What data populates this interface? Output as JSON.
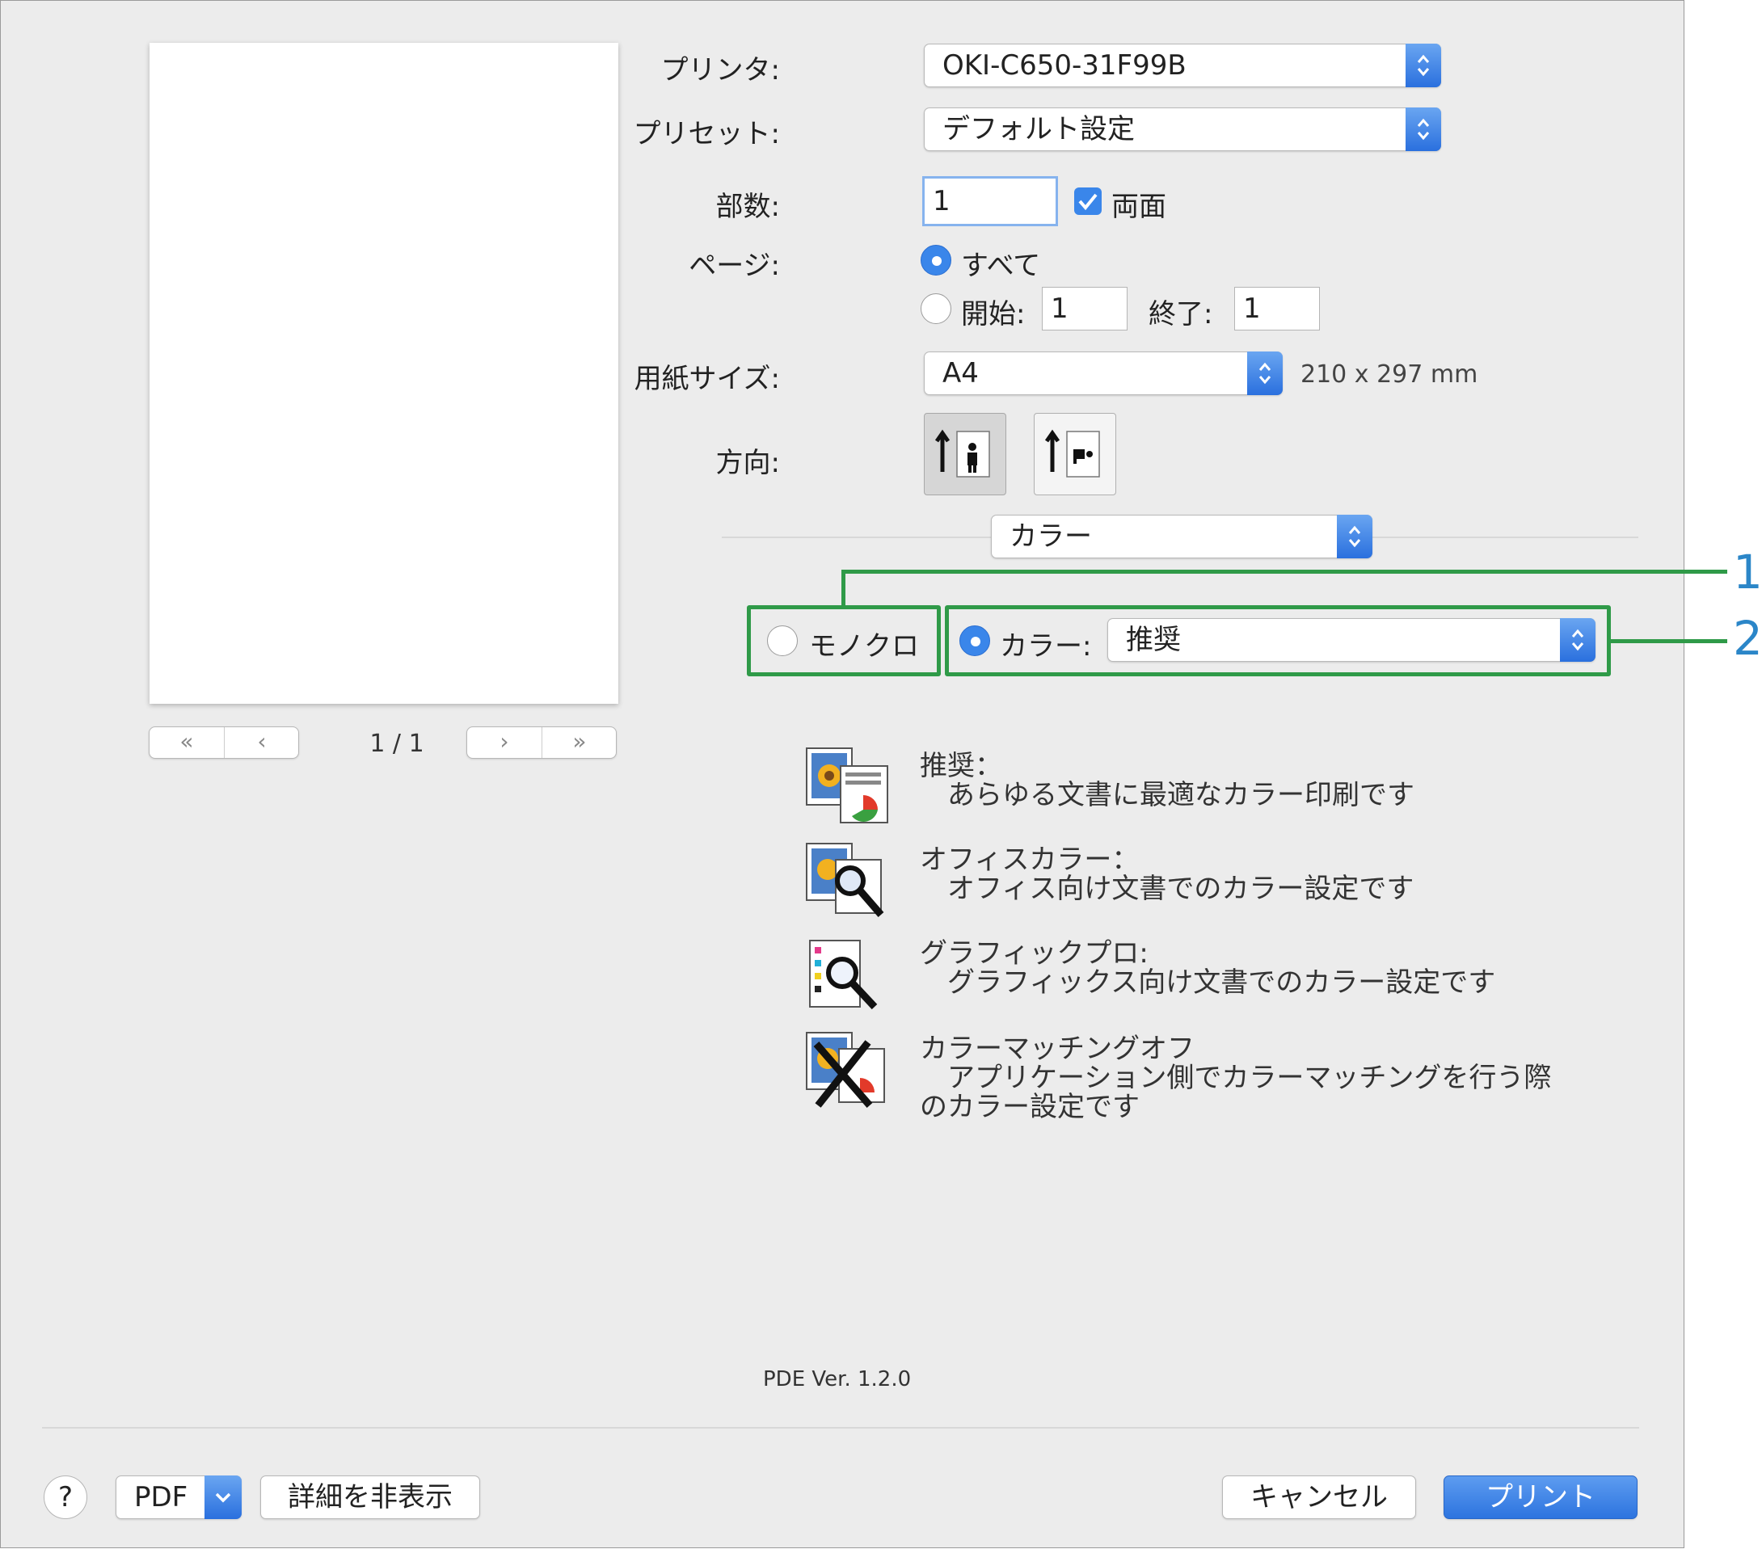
{
  "printer": {
    "label": "プリンタ:",
    "value": "OKI-C650-31F99B"
  },
  "preset": {
    "label": "プリセット:",
    "value": "デフォルト設定"
  },
  "copies": {
    "label": "部数:",
    "value": "1",
    "duplex_label": "両面",
    "duplex_checked": true
  },
  "pages": {
    "label": "ページ:",
    "all_label": "すべて",
    "from_label": "開始:",
    "from_value": "1",
    "to_label": "終了:",
    "to_value": "1"
  },
  "paper": {
    "label": "用紙サイズ:",
    "value": "A4",
    "dimensions": "210 x 297 mm"
  },
  "orientation": {
    "label": "方向:"
  },
  "panel_select": {
    "value": "カラー"
  },
  "color_mode": {
    "mono_label": "モノクロ",
    "color_label": "カラー:",
    "color_value": "推奨",
    "selected": "color"
  },
  "callouts": [
    "1",
    "2"
  ],
  "preview": {
    "page_indicator": "1 / 1"
  },
  "descriptions": [
    {
      "title": "推奨：",
      "lines": [
        "あらゆる文書に最適なカラー印刷です"
      ],
      "icon": "recommended-color-icon"
    },
    {
      "title": "オフィスカラー：",
      "lines": [
        "オフィス向け文書でのカラー設定です"
      ],
      "icon": "office-color-icon"
    },
    {
      "title": "グラフィックプロ:",
      "lines": [
        "グラフィックス向け文書でのカラー設定です"
      ],
      "icon": "graphic-pro-icon"
    },
    {
      "title": "カラーマッチングオフ",
      "lines": [
        "アプリケーション側でカラーマッチングを行う際",
        "のカラー設定です"
      ],
      "icon": "color-matching-off-icon"
    }
  ],
  "version": "PDE Ver. 1.2.0",
  "footer": {
    "help": "?",
    "pdf": "PDF",
    "hide_details": "詳細を非表示",
    "cancel": "キャンセル",
    "print": "プリント"
  },
  "colors": {
    "accent": "#3a86ea",
    "highlight": "#2f9a48",
    "callout": "#2b86c8"
  }
}
